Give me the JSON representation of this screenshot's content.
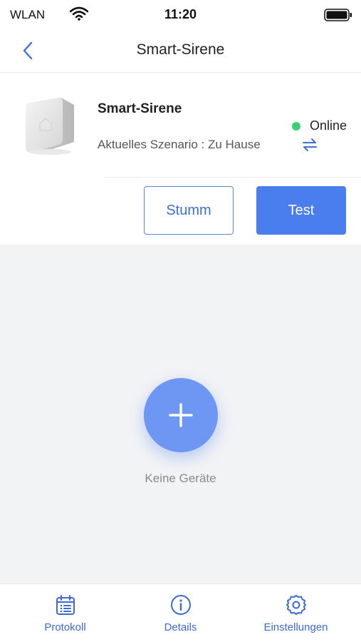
{
  "status_bar": {
    "carrier": "WLAN",
    "time": "11:20",
    "wifi_icon": "wifi-icon",
    "battery_icon": "battery-icon"
  },
  "nav": {
    "title": "Smart-Sirene",
    "back_icon": "chevron-left-icon"
  },
  "device": {
    "name": "Smart-Sirene",
    "scenario": "Aktuelles Szenario : Zu Hause",
    "status": "Online",
    "status_color": "#3ccf74",
    "swap_icon": "swap-arrows-icon"
  },
  "actions": {
    "mute_label": "Stumm",
    "test_label": "Test"
  },
  "empty_state": {
    "label": "Keine Geräte",
    "add_icon": "plus-icon"
  },
  "tabs": [
    {
      "label": "Protokoll",
      "icon": "calendar-list-icon"
    },
    {
      "label": "Details",
      "icon": "info-icon"
    },
    {
      "label": "Einstellungen",
      "icon": "gear-icon"
    }
  ],
  "colors": {
    "accent": "#4a7eee",
    "background": "#f2f3f5"
  }
}
